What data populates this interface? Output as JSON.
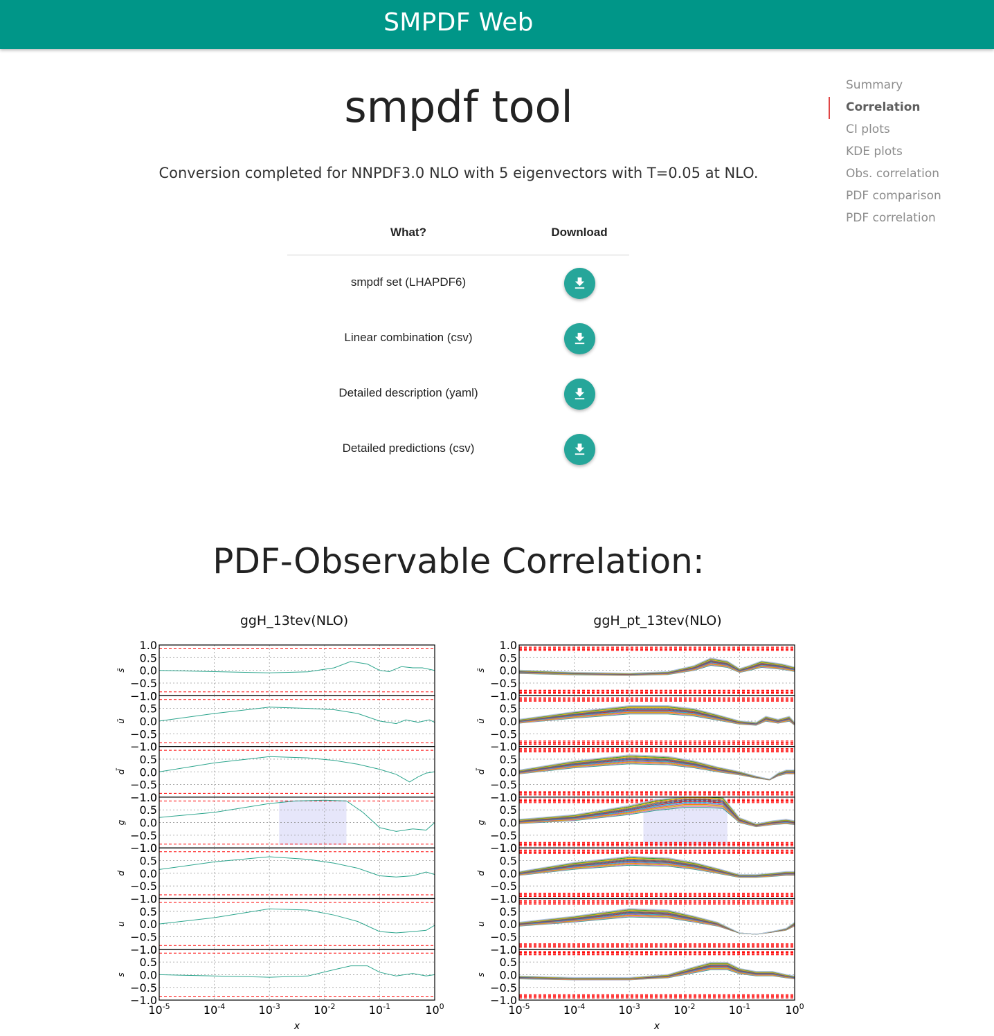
{
  "header": {
    "brand": "SMPDF Web"
  },
  "toc": {
    "items": [
      {
        "label": "Summary",
        "active": false
      },
      {
        "label": "Correlation",
        "active": true
      },
      {
        "label": "CI plots",
        "active": false
      },
      {
        "label": "KDE plots",
        "active": false
      },
      {
        "label": "Obs. correlation",
        "active": false
      },
      {
        "label": "PDF comparison",
        "active": false
      },
      {
        "label": "PDF correlation",
        "active": false
      }
    ]
  },
  "main": {
    "title": "smpdf tool",
    "summary": "Conversion completed for NNPDF3.0 NLO with 5 eigenvectors with T=0.05 at NLO.",
    "table": {
      "headers": {
        "what": "What?",
        "download": "Download"
      },
      "rows": [
        {
          "label": "smpdf set (LHAPDF6)",
          "icon": "download-icon"
        },
        {
          "label": "Linear combination (csv)",
          "icon": "download-icon"
        },
        {
          "label": "Detailed description (yaml)",
          "icon": "download-icon"
        },
        {
          "label": "Detailed predictions (csv)",
          "icon": "download-icon"
        }
      ]
    },
    "section_title": "PDF-Observable Correlation:"
  },
  "colors": {
    "topbar": "#009688",
    "button": "#26a69a",
    "active_marker": "#e04545",
    "threshold": "#ff0000",
    "curve": "#2ca58d",
    "band": "#e6e6fa"
  },
  "chart_data": [
    {
      "type": "line",
      "title": "ggH_13tev(NLO)",
      "xlabel": "x",
      "xscale": "log",
      "xlim": [
        1e-05,
        1
      ],
      "x_ticks": [
        "10-5",
        "10-4",
        "10-3",
        "10-2",
        "10-1",
        "100"
      ],
      "ylim": [
        -1.0,
        1.0
      ],
      "y_ticks": [
        "1.0",
        "0.5",
        "0.0",
        "−0.5",
        "−1.0"
      ],
      "grid": true,
      "panels": [
        "s̄",
        "ū",
        "d̄",
        "g",
        "d",
        "u",
        "s"
      ],
      "thresholds": [
        0.85,
        -0.85
      ],
      "series": [
        {
          "panel": "s̄",
          "x": [
            1e-05,
            0.0001,
            0.001,
            0.005,
            0.015,
            0.03,
            0.06,
            0.1,
            0.15,
            0.25,
            0.4,
            0.6,
            1.0
          ],
          "y": [
            0.0,
            -0.05,
            -0.1,
            -0.06,
            0.1,
            0.35,
            0.25,
            0.0,
            -0.05,
            0.15,
            0.1,
            0.1,
            0.0
          ]
        },
        {
          "panel": "ū",
          "x": [
            1e-05,
            0.0001,
            0.001,
            0.005,
            0.015,
            0.04,
            0.1,
            0.2,
            0.3,
            0.5,
            0.8,
            1.0
          ],
          "y": [
            0.0,
            0.3,
            0.55,
            0.5,
            0.45,
            0.3,
            0.0,
            -0.1,
            0.05,
            -0.05,
            0.05,
            -0.05
          ]
        },
        {
          "panel": "d̄",
          "x": [
            1e-05,
            0.0001,
            0.001,
            0.005,
            0.015,
            0.04,
            0.1,
            0.2,
            0.35,
            0.5,
            0.7,
            1.0
          ],
          "y": [
            0.0,
            0.35,
            0.6,
            0.55,
            0.45,
            0.3,
            0.1,
            -0.1,
            -0.4,
            -0.2,
            -0.05,
            0.0
          ]
        },
        {
          "panel": "g",
          "x": [
            1e-05,
            0.0001,
            0.001,
            0.003,
            0.01,
            0.025,
            0.05,
            0.1,
            0.2,
            0.4,
            0.7,
            1.0
          ],
          "y": [
            0.2,
            0.4,
            0.75,
            0.85,
            0.88,
            0.85,
            0.4,
            -0.2,
            -0.35,
            -0.25,
            -0.3,
            0.0
          ]
        },
        {
          "panel": "d",
          "x": [
            1e-05,
            0.0001,
            0.001,
            0.005,
            0.015,
            0.04,
            0.1,
            0.2,
            0.4,
            0.7,
            1.0
          ],
          "y": [
            0.15,
            0.45,
            0.65,
            0.55,
            0.4,
            0.2,
            -0.1,
            -0.15,
            -0.1,
            0.05,
            -0.05
          ]
        },
        {
          "panel": "u",
          "x": [
            1e-05,
            0.0001,
            0.001,
            0.005,
            0.015,
            0.04,
            0.1,
            0.2,
            0.4,
            0.7,
            1.0
          ],
          "y": [
            0.0,
            0.25,
            0.6,
            0.55,
            0.35,
            0.1,
            -0.3,
            -0.35,
            -0.3,
            -0.25,
            -0.05
          ]
        },
        {
          "panel": "s",
          "x": [
            1e-05,
            0.0001,
            0.001,
            0.005,
            0.015,
            0.03,
            0.06,
            0.1,
            0.2,
            0.4,
            0.7,
            1.0
          ],
          "y": [
            0.0,
            -0.05,
            -0.1,
            -0.05,
            0.2,
            0.35,
            0.35,
            0.1,
            -0.05,
            0.05,
            -0.05,
            0.0
          ]
        }
      ],
      "highlight": {
        "panel": "g",
        "x_range": [
          0.0015,
          0.025
        ]
      }
    },
    {
      "type": "line",
      "title": "ggH_pt_13tev(NLO)",
      "xlabel": "x",
      "xscale": "log",
      "xlim": [
        1e-05,
        1
      ],
      "x_ticks": [
        "10-5",
        "10-4",
        "10-3",
        "10-2",
        "10-1",
        "100"
      ],
      "ylim": [
        -1.0,
        1.0
      ],
      "y_ticks": [
        "1.0",
        "0.5",
        "0.0",
        "−0.5",
        "−1.0"
      ],
      "grid": true,
      "panels": [
        "s̄",
        "ū",
        "d̄",
        "g",
        "d",
        "u",
        "s"
      ],
      "thresholds": [
        0.85,
        -0.85
      ],
      "series_count_per_panel": 14,
      "series": [
        {
          "panel": "s̄",
          "x": [
            1e-05,
            0.0001,
            0.001,
            0.005,
            0.015,
            0.03,
            0.06,
            0.1,
            0.15,
            0.25,
            0.4,
            0.6,
            1.0
          ],
          "y": [
            -0.05,
            -0.12,
            -0.15,
            -0.1,
            0.1,
            0.35,
            0.25,
            0.0,
            0.1,
            0.25,
            0.2,
            0.15,
            0.05
          ]
        },
        {
          "panel": "ū",
          "x": [
            1e-05,
            0.0001,
            0.001,
            0.005,
            0.015,
            0.04,
            0.1,
            0.2,
            0.3,
            0.5,
            0.8,
            1.0
          ],
          "y": [
            0.0,
            0.25,
            0.45,
            0.45,
            0.35,
            0.15,
            -0.05,
            -0.1,
            0.1,
            0.0,
            0.1,
            -0.1
          ]
        },
        {
          "panel": "d̄",
          "x": [
            1e-05,
            0.0001,
            0.001,
            0.005,
            0.015,
            0.04,
            0.1,
            0.2,
            0.35,
            0.5,
            0.7,
            1.0
          ],
          "y": [
            0.0,
            0.3,
            0.5,
            0.45,
            0.3,
            0.1,
            -0.05,
            -0.2,
            -0.3,
            -0.1,
            0.0,
            0.0
          ]
        },
        {
          "panel": "g",
          "x": [
            1e-05,
            0.0001,
            0.001,
            0.003,
            0.01,
            0.025,
            0.05,
            0.1,
            0.2,
            0.4,
            0.7,
            1.0
          ],
          "y": [
            0.05,
            0.2,
            0.5,
            0.7,
            0.85,
            0.85,
            0.8,
            0.1,
            -0.1,
            0.0,
            0.05,
            0.0
          ]
        },
        {
          "panel": "d",
          "x": [
            1e-05,
            0.0001,
            0.001,
            0.005,
            0.015,
            0.04,
            0.1,
            0.2,
            0.4,
            0.7,
            1.0
          ],
          "y": [
            0.0,
            0.3,
            0.5,
            0.45,
            0.3,
            0.1,
            -0.1,
            -0.1,
            -0.05,
            0.0,
            0.0
          ]
        },
        {
          "panel": "u",
          "x": [
            1e-05,
            0.0001,
            0.001,
            0.005,
            0.015,
            0.04,
            0.1,
            0.2,
            0.4,
            0.7,
            1.0
          ],
          "y": [
            0.0,
            0.2,
            0.45,
            0.4,
            0.2,
            0.0,
            -0.35,
            -0.4,
            -0.3,
            -0.2,
            0.0
          ]
        },
        {
          "panel": "s",
          "x": [
            1e-05,
            0.0001,
            0.001,
            0.005,
            0.015,
            0.03,
            0.06,
            0.1,
            0.2,
            0.4,
            0.7,
            1.0
          ],
          "y": [
            -0.1,
            -0.15,
            -0.15,
            -0.05,
            0.2,
            0.35,
            0.35,
            0.15,
            0.05,
            0.05,
            -0.05,
            -0.1
          ]
        }
      ],
      "highlight": {
        "panel": "g",
        "x_range": [
          0.0018,
          0.06
        ]
      }
    }
  ]
}
